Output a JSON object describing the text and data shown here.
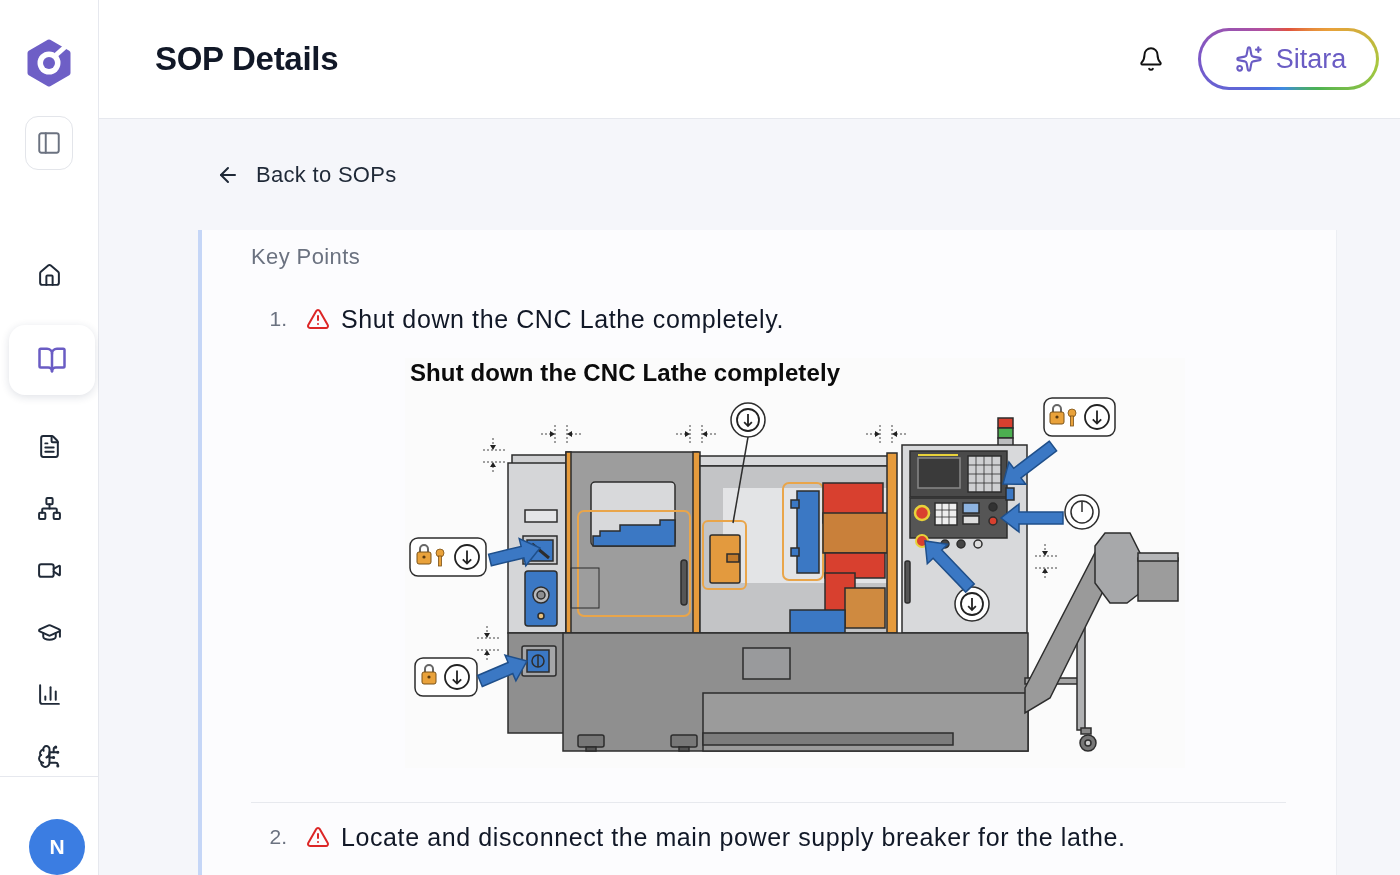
{
  "sidebar": {
    "nav_items": [
      {
        "selected": false
      },
      {
        "selected": true
      },
      {
        "selected": false
      },
      {
        "selected": false
      },
      {
        "selected": false
      },
      {
        "selected": false
      },
      {
        "selected": false
      },
      {
        "selected": false
      }
    ],
    "avatar": {
      "initial": "N"
    }
  },
  "header": {
    "title": "SOP Details",
    "assistant_button": {
      "label": "Sitara"
    }
  },
  "back_link": {
    "label": "Back to SOPs"
  },
  "key_points": {
    "heading": "Key Points",
    "items": [
      {
        "number": "1.",
        "kind": "warning",
        "text": "Shut down the CNC Lathe completely.",
        "figure": {
          "title": "Shut down the CNC Lathe completely"
        }
      },
      {
        "number": "2.",
        "kind": "warning",
        "text": "Locate and disconnect the main power supply breaker for the lathe."
      }
    ]
  }
}
